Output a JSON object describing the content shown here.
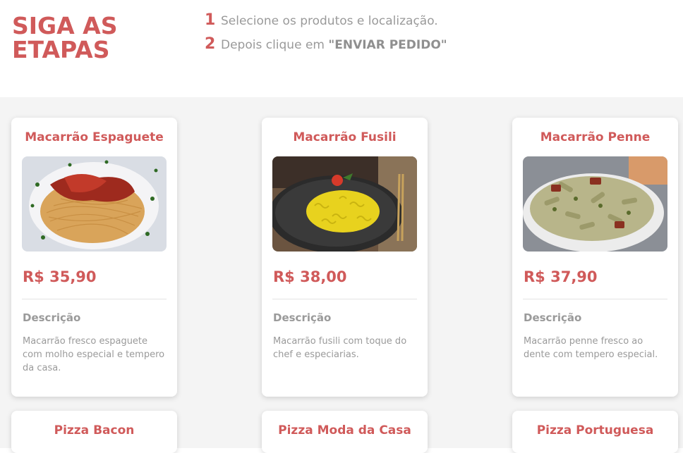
{
  "header": {
    "title_line1": "SIGA AS",
    "title_line2": "ETAPAS",
    "steps": [
      {
        "num": "1",
        "text": "Selecione os produtos e localização."
      },
      {
        "num": "2",
        "text_prefix": "Depois clique em ",
        "text_bold": "\"ENVIAR PEDIDO\""
      }
    ]
  },
  "products": [
    {
      "name": "Macarrão Espaguete",
      "price": "R$ 35,90",
      "desc_title": "Descrição",
      "desc": "Macarrão fresco espaguete com molho especial e tempero da casa.",
      "image": "spaghetti-photo"
    },
    {
      "name": "Macarrão Fusili",
      "price": "R$ 38,00",
      "desc_title": "Descrição",
      "desc": "Macarrão fusili com toque do chef e especiarias.",
      "image": "fusilli-photo"
    },
    {
      "name": "Macarrão Penne",
      "price": "R$ 37,90",
      "desc_title": "Descrição",
      "desc": "Macarrão penne fresco ao dente com tempero especial.",
      "image": "penne-photo"
    },
    {
      "name": "Pizza Bacon"
    },
    {
      "name": "Pizza Moda da Casa"
    },
    {
      "name": "Pizza Portuguesa"
    }
  ],
  "colors": {
    "accent": "#d05a5a",
    "muted_text": "#9a9a9a",
    "background": "#f4f4f4"
  }
}
